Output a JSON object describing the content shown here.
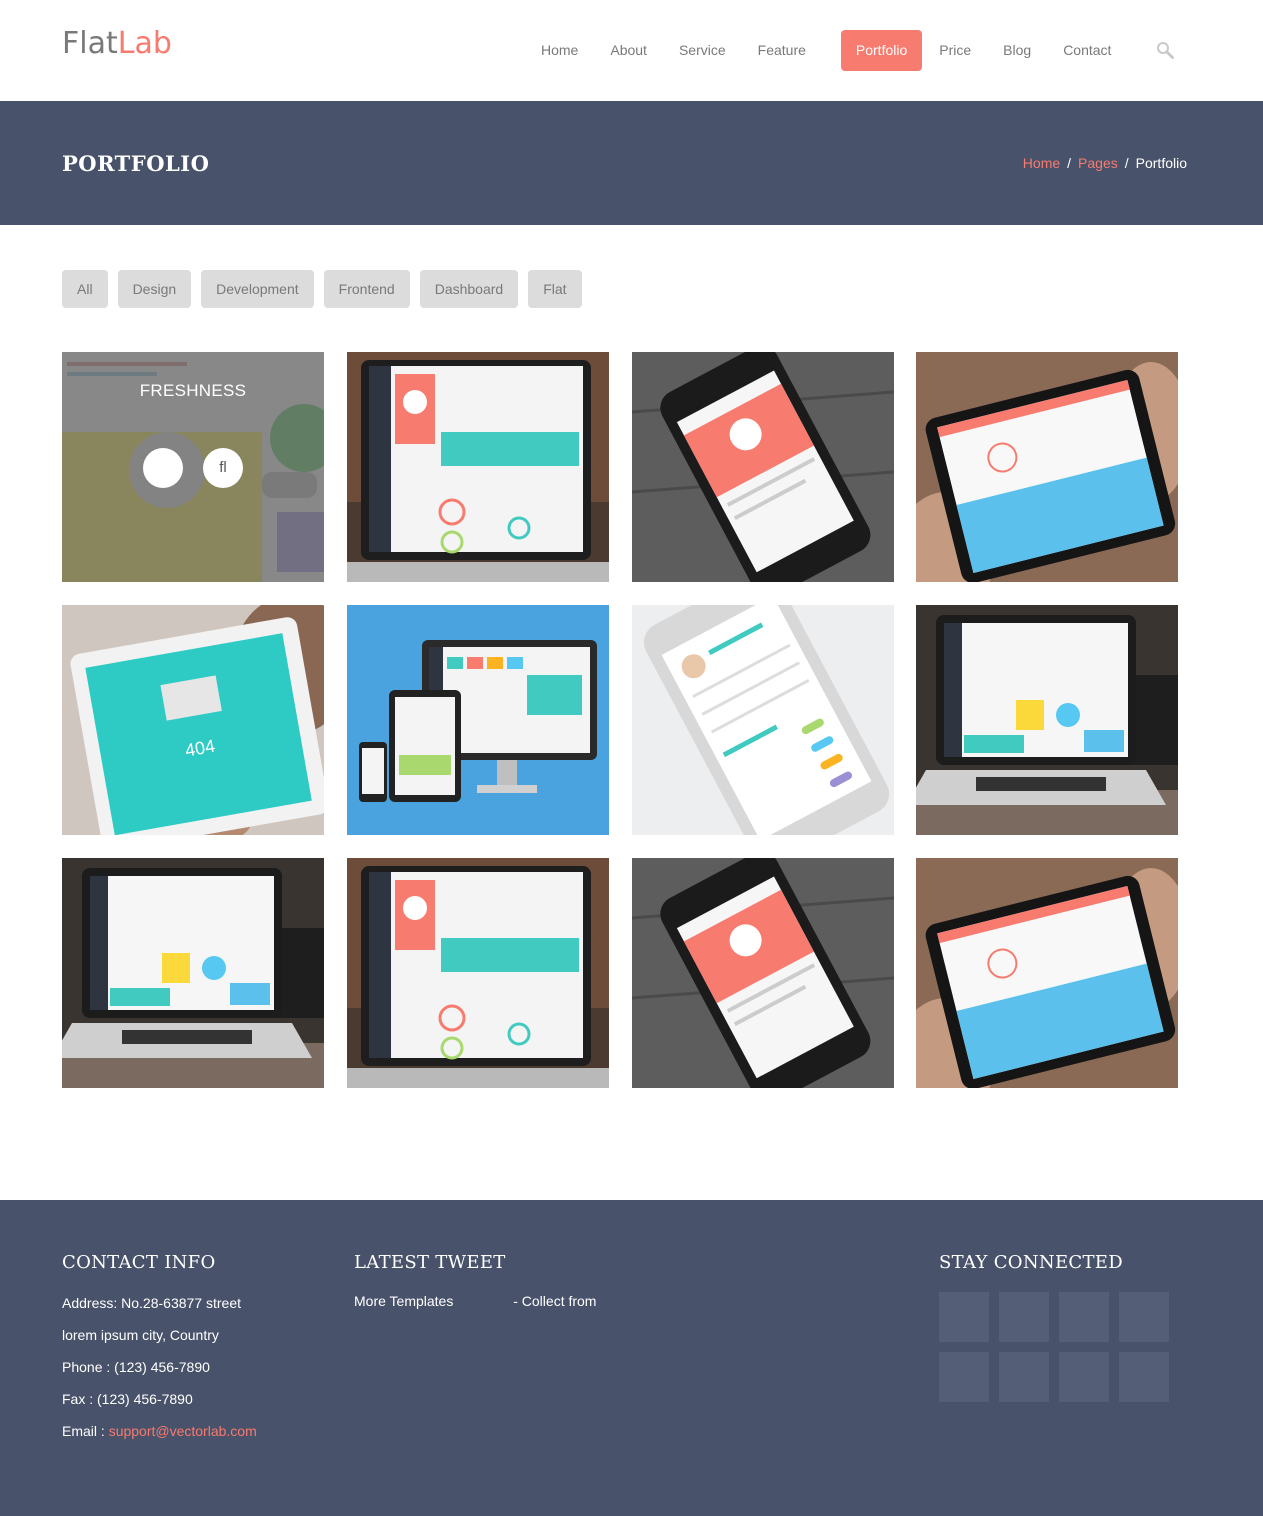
{
  "brand": {
    "part1": "Flat",
    "part2": "Lab"
  },
  "nav": {
    "items": [
      "Home",
      "About",
      "Service",
      "Feature",
      "Portfolio",
      "Price",
      "Blog",
      "Contact"
    ],
    "active": "Portfolio",
    "search_icon": "search-icon"
  },
  "band": {
    "title": "PORTFOLIO",
    "breadcrumb": [
      "Home",
      "Pages",
      "Portfolio"
    ],
    "separator": "/"
  },
  "filters": [
    "All",
    "Design",
    "Development",
    "Frontend",
    "Dashboard",
    "Flat"
  ],
  "portfolio": {
    "hover_title": "FRESHNESS",
    "hover_btn_link": "",
    "hover_btn_zoom": "fl",
    "tiles": [
      "dashboard-overlay",
      "laptop-profile",
      "phone-profile",
      "tablet-dashboard",
      "tablet-404",
      "responsive-devices",
      "phone-list",
      "laptop-dashboard",
      "laptop-dashboard-2",
      "laptop-profile-2",
      "phone-profile-2",
      "tablet-dashboard-2"
    ]
  },
  "footer": {
    "contact_heading": "CONTACT  INFO",
    "address": "Address: No.28-63877 street",
    "city": "lorem ipsum city, Country",
    "phone": "Phone : (123) 456-7890",
    "fax": "Fax : (123) 456-7890",
    "email_label": "Email : ",
    "email": "support@vectorlab.com",
    "tweet_heading": "LATEST  TWEET",
    "tweet_part1": "More Templates ",
    "tweet_part2": "- Collect from",
    "social_heading": "STAY  CONNECTED"
  },
  "colors": {
    "accent": "#f77b6f",
    "band": "#48526a",
    "text": "#797979"
  }
}
